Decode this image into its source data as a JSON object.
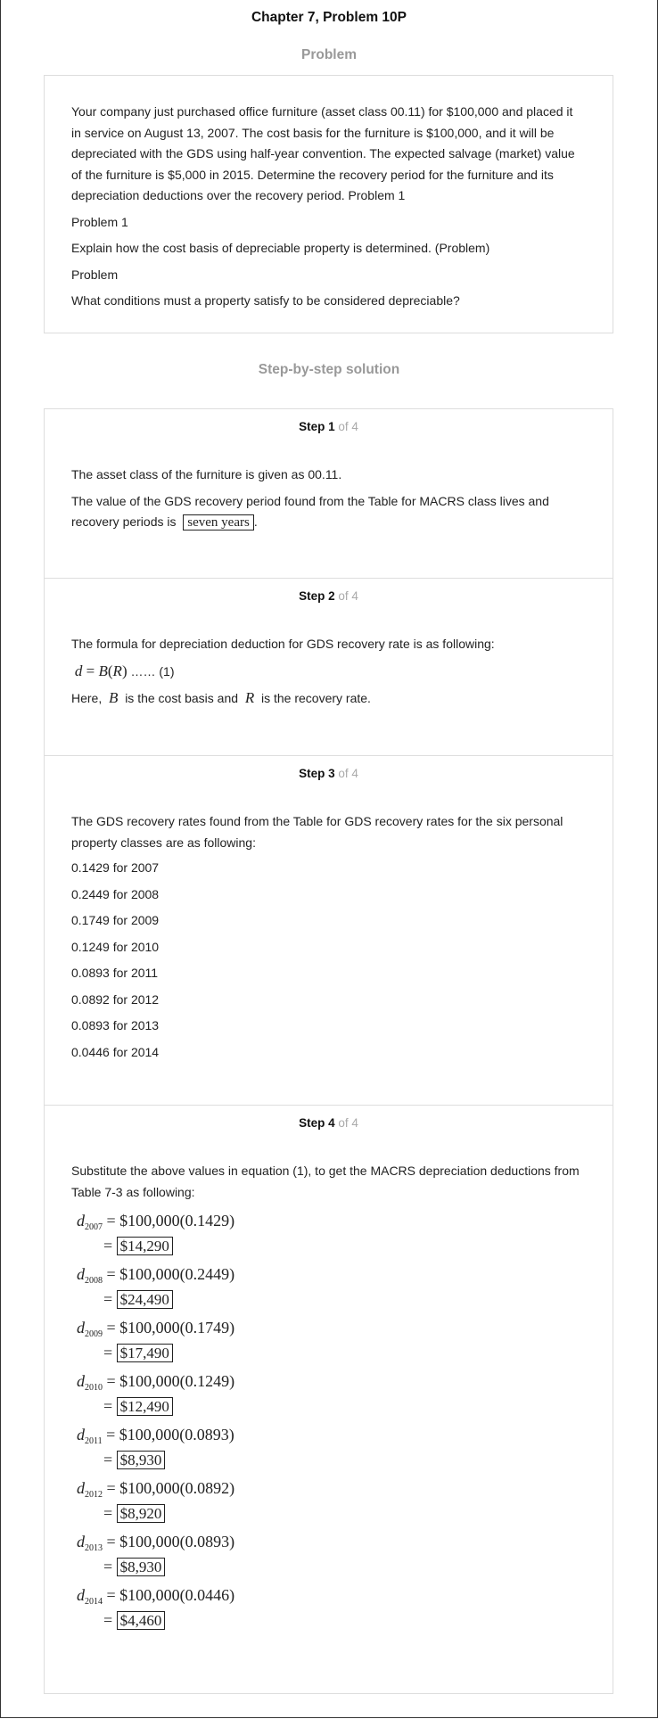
{
  "title": "Chapter 7, Problem 10P",
  "problem_heading": "Problem",
  "problem_paragraphs": [
    "Your company just purchased office furniture (asset class 00.11) for $100,000 and placed it in service on August 13, 2007. The cost basis for the furniture is $100,000, and it will be depreciated with the GDS using half-year convention. The expected salvage (market) value of the furniture is $5,000 in 2015. Determine the recovery period for the furniture and its depreciation deductions over the recovery period. Problem 1",
    "Problem 1",
    "Explain how the cost basis of depreciable property is determined. (Problem)",
    "Problem",
    "What conditions must a property satisfy to be considered depreciable?"
  ],
  "solution_heading": "Step-by-step solution",
  "step_word": "Step",
  "of_total": "of 4",
  "steps": [
    {
      "number": "1",
      "line1": "The asset class of the furniture is given as 00.11.",
      "line2": "The value of the GDS recovery period found from the Table for MACRS class lives and recovery periods is",
      "answer": "seven years",
      "end": "."
    },
    {
      "number": "2",
      "intro": "The formula for depreciation deduction for GDS recovery rate is as following:",
      "formula_lhs": "d",
      "formula_eq": " = ",
      "formula_b": "B",
      "formula_r": "R",
      "formula_tag": "…… (1)",
      "here": "Here,",
      "b_sym": "B",
      "b_desc": "is the cost basis and",
      "r_sym": "R",
      "r_desc": "is the recovery rate."
    },
    {
      "number": "3",
      "intro": "The GDS recovery rates found from the Table for GDS recovery rates for the six personal property classes are as following:",
      "rates": [
        "0.1429 for 2007",
        "0.2449 for 2008",
        "0.1749 for 2009",
        "0.1249 for 2010",
        "0.0893 for 2011",
        "0.0892 for 2012",
        "0.0893 for 2013",
        "0.0446 for 2014"
      ]
    },
    {
      "number": "4",
      "intro": "Substitute the above values in equation (1), to get the MACRS depreciation deductions from Table 7-3 as following:",
      "equations": [
        {
          "year": "2007",
          "expr": "$100,000(0.1429)",
          "result": "$14,290"
        },
        {
          "year": "2008",
          "expr": "$100,000(0.2449)",
          "result": "$24,490"
        },
        {
          "year": "2009",
          "expr": "$100,000(0.1749)",
          "result": "$17,490"
        },
        {
          "year": "2010",
          "expr": "$100,000(0.1249)",
          "result": "$12,490"
        },
        {
          "year": "2011",
          "expr": "$100,000(0.0893)",
          "result": "$8,930"
        },
        {
          "year": "2012",
          "expr": "$100,000(0.0892)",
          "result": "$8,920"
        },
        {
          "year": "2013",
          "expr": "$100,000(0.0893)",
          "result": "$8,930"
        },
        {
          "year": "2014",
          "expr": "$100,000(0.0446)",
          "result": "$4,460"
        }
      ]
    }
  ]
}
